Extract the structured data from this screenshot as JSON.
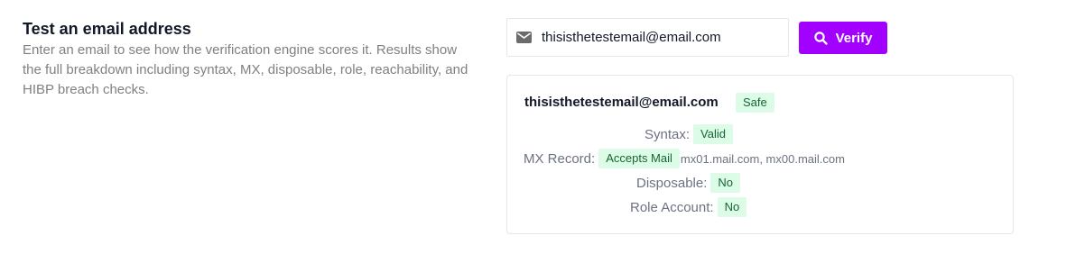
{
  "intro": {
    "title": "Test an email address",
    "description_line1": "Enter an email to see how the verification engine scores it. Results show",
    "description_line2": "the full breakdown including syntax, MX, disposable, role, reachability, and",
    "description_line3": "HIBP breach checks."
  },
  "form": {
    "email_value": "thisisthetestemail@email.com",
    "verify_label": "Verify",
    "icons": {
      "input": "mail-icon",
      "button": "search-icon"
    }
  },
  "result": {
    "email": "thisisthetestemail@email.com",
    "status": "Safe",
    "syntax_label": "Syntax:",
    "syntax_value": "Valid",
    "mx_label": "MX Record:",
    "mx_value": "Accepts Mail",
    "mx_hosts": "mx01.mail.com, mx00.mail.com",
    "disposable_label": "Disposable:",
    "disposable_value": "No",
    "role_label": "Role Account:",
    "role_value": "No"
  },
  "colors": {
    "accent": "#a200ff",
    "badge_bg": "#dcfce7",
    "badge_text": "#166534"
  }
}
